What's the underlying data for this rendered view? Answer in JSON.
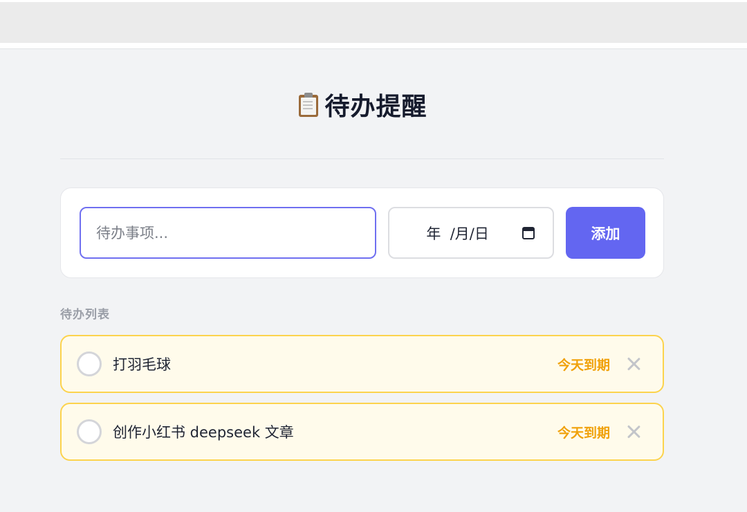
{
  "header": {
    "icon": "clipboard-icon",
    "title": "待办提醒"
  },
  "form": {
    "task_placeholder": "待办事项...",
    "task_value": "",
    "date_display": "  年  /月/日",
    "date_icon": "calendar-icon",
    "add_label": "添加"
  },
  "list": {
    "heading": "待办列表",
    "items": [
      {
        "text": "打羽毛球",
        "due": "今天到期",
        "delete_icon": "close-icon"
      },
      {
        "text": "创作小红书 deepseek 文章",
        "due": "今天到期",
        "delete_icon": "close-icon"
      }
    ]
  },
  "colors": {
    "accent": "#6366f1",
    "due_text": "#f0a10a",
    "item_border": "#fcd34d",
    "item_background": "#fffbeb"
  }
}
